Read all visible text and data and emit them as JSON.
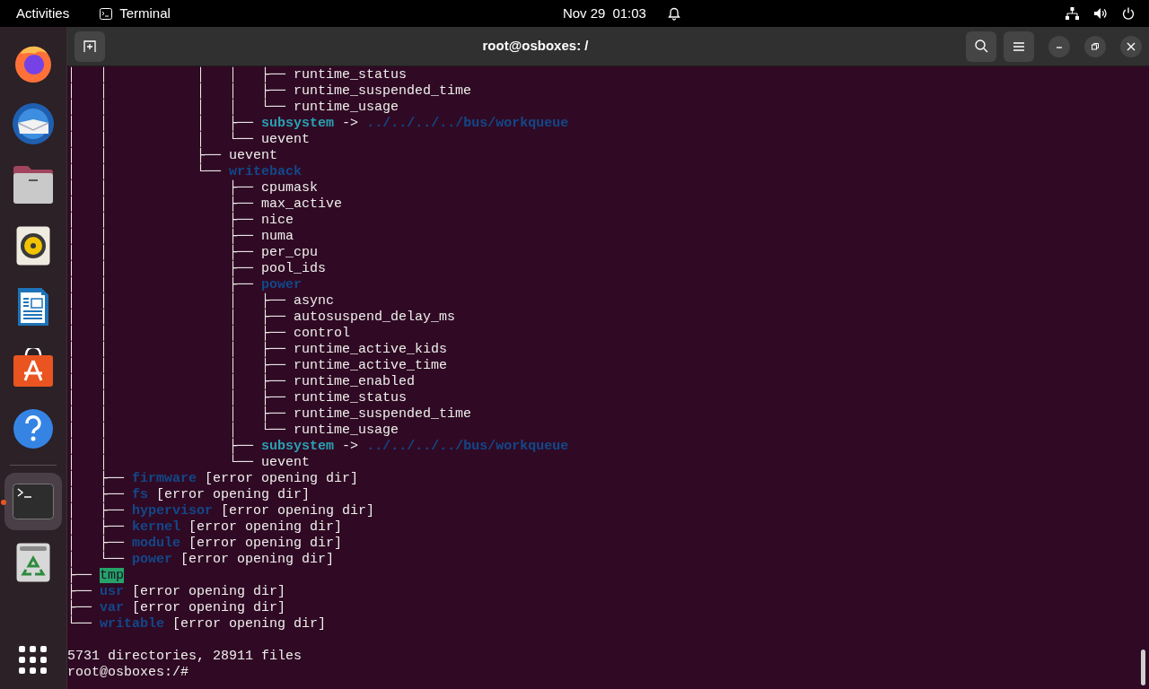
{
  "top_bar": {
    "activities": "Activities",
    "app_name": "Terminal",
    "date": "Nov 29",
    "time": "01:03"
  },
  "dock": {
    "items": [
      {
        "kind": "browser",
        "active": false
      },
      {
        "kind": "mail",
        "active": false
      },
      {
        "kind": "files",
        "active": false
      },
      {
        "kind": "music",
        "active": false
      },
      {
        "kind": "writer",
        "active": false
      },
      {
        "kind": "store",
        "active": false
      },
      {
        "kind": "help",
        "active": false
      },
      {
        "kind": "terminal",
        "active": true
      },
      {
        "kind": "trash",
        "active": false
      }
    ]
  },
  "window": {
    "title": "root@osboxes: /"
  },
  "terminal": {
    "lines": [
      {
        "prefix": "│   │           │   │   ├──",
        "segments": [
          {
            "text": "runtime_status",
            "kind": "file"
          }
        ]
      },
      {
        "prefix": "│   │           │   │   ├──",
        "segments": [
          {
            "text": "runtime_suspended_time",
            "kind": "file"
          }
        ]
      },
      {
        "prefix": "│   │           │   │   └──",
        "segments": [
          {
            "text": "runtime_usage",
            "kind": "file"
          }
        ]
      },
      {
        "prefix": "│   │           │   ├──",
        "segments": [
          {
            "text": "subsystem",
            "kind": "link"
          },
          {
            "text": "->",
            "kind": "arrow"
          },
          {
            "text": "../../../../bus/workqueue",
            "kind": "dir"
          }
        ]
      },
      {
        "prefix": "│   │           │   └──",
        "segments": [
          {
            "text": "uevent",
            "kind": "file"
          }
        ]
      },
      {
        "prefix": "│   │           ├──",
        "segments": [
          {
            "text": "uevent",
            "kind": "file"
          }
        ]
      },
      {
        "prefix": "│   │           └──",
        "segments": [
          {
            "text": "writeback",
            "kind": "dir"
          }
        ]
      },
      {
        "prefix": "│   │               ├──",
        "segments": [
          {
            "text": "cpumask",
            "kind": "file"
          }
        ]
      },
      {
        "prefix": "│   │               ├──",
        "segments": [
          {
            "text": "max_active",
            "kind": "file"
          }
        ]
      },
      {
        "prefix": "│   │               ├──",
        "segments": [
          {
            "text": "nice",
            "kind": "file"
          }
        ]
      },
      {
        "prefix": "│   │               ├──",
        "segments": [
          {
            "text": "numa",
            "kind": "file"
          }
        ]
      },
      {
        "prefix": "│   │               ├──",
        "segments": [
          {
            "text": "per_cpu",
            "kind": "file"
          }
        ]
      },
      {
        "prefix": "│   │               ├──",
        "segments": [
          {
            "text": "pool_ids",
            "kind": "file"
          }
        ]
      },
      {
        "prefix": "│   │               ├──",
        "segments": [
          {
            "text": "power",
            "kind": "dir"
          }
        ]
      },
      {
        "prefix": "│   │               │   ├──",
        "segments": [
          {
            "text": "async",
            "kind": "file"
          }
        ]
      },
      {
        "prefix": "│   │               │   ├──",
        "segments": [
          {
            "text": "autosuspend_delay_ms",
            "kind": "file"
          }
        ]
      },
      {
        "prefix": "│   │               │   ├──",
        "segments": [
          {
            "text": "control",
            "kind": "file"
          }
        ]
      },
      {
        "prefix": "│   │               │   ├──",
        "segments": [
          {
            "text": "runtime_active_kids",
            "kind": "file"
          }
        ]
      },
      {
        "prefix": "│   │               │   ├──",
        "segments": [
          {
            "text": "runtime_active_time",
            "kind": "file"
          }
        ]
      },
      {
        "prefix": "│   │               │   ├──",
        "segments": [
          {
            "text": "runtime_enabled",
            "kind": "file"
          }
        ]
      },
      {
        "prefix": "│   │               │   ├──",
        "segments": [
          {
            "text": "runtime_status",
            "kind": "file"
          }
        ]
      },
      {
        "prefix": "│   │               │   ├──",
        "segments": [
          {
            "text": "runtime_suspended_time",
            "kind": "file"
          }
        ]
      },
      {
        "prefix": "│   │               │   └──",
        "segments": [
          {
            "text": "runtime_usage",
            "kind": "file"
          }
        ]
      },
      {
        "prefix": "│   │               ├──",
        "segments": [
          {
            "text": "subsystem",
            "kind": "link"
          },
          {
            "text": "->",
            "kind": "arrow"
          },
          {
            "text": "../../../../bus/workqueue",
            "kind": "dir"
          }
        ]
      },
      {
        "prefix": "│   │               └──",
        "segments": [
          {
            "text": "uevent",
            "kind": "file"
          }
        ]
      },
      {
        "prefix": "│   ├──",
        "segments": [
          {
            "text": "firmware",
            "kind": "dir"
          },
          {
            "text": "[error opening dir]",
            "kind": "error"
          }
        ]
      },
      {
        "prefix": "│   ├──",
        "segments": [
          {
            "text": "fs",
            "kind": "dir"
          },
          {
            "text": "[error opening dir]",
            "kind": "error"
          }
        ]
      },
      {
        "prefix": "│   ├──",
        "segments": [
          {
            "text": "hypervisor",
            "kind": "dir"
          },
          {
            "text": "[error opening dir]",
            "kind": "error"
          }
        ]
      },
      {
        "prefix": "│   ├──",
        "segments": [
          {
            "text": "kernel",
            "kind": "dir"
          },
          {
            "text": "[error opening dir]",
            "kind": "error"
          }
        ]
      },
      {
        "prefix": "│   ├──",
        "segments": [
          {
            "text": "module",
            "kind": "dir"
          },
          {
            "text": "[error opening dir]",
            "kind": "error"
          }
        ]
      },
      {
        "prefix": "│   └──",
        "segments": [
          {
            "text": "power",
            "kind": "dir"
          },
          {
            "text": "[error opening dir]",
            "kind": "error"
          }
        ]
      },
      {
        "prefix": "├──",
        "segments": [
          {
            "text": "tmp",
            "kind": "sticky"
          }
        ]
      },
      {
        "prefix": "├──",
        "segments": [
          {
            "text": "usr",
            "kind": "dir"
          },
          {
            "text": "[error opening dir]",
            "kind": "error"
          }
        ]
      },
      {
        "prefix": "├──",
        "segments": [
          {
            "text": "var",
            "kind": "dir"
          },
          {
            "text": "[error opening dir]",
            "kind": "error"
          }
        ]
      },
      {
        "prefix": "└──",
        "segments": [
          {
            "text": "writable",
            "kind": "dir"
          },
          {
            "text": "[error opening dir]",
            "kind": "error"
          }
        ]
      }
    ],
    "summary": "5731 directories, 28911 files",
    "prompt": "root@osboxes:/#"
  }
}
